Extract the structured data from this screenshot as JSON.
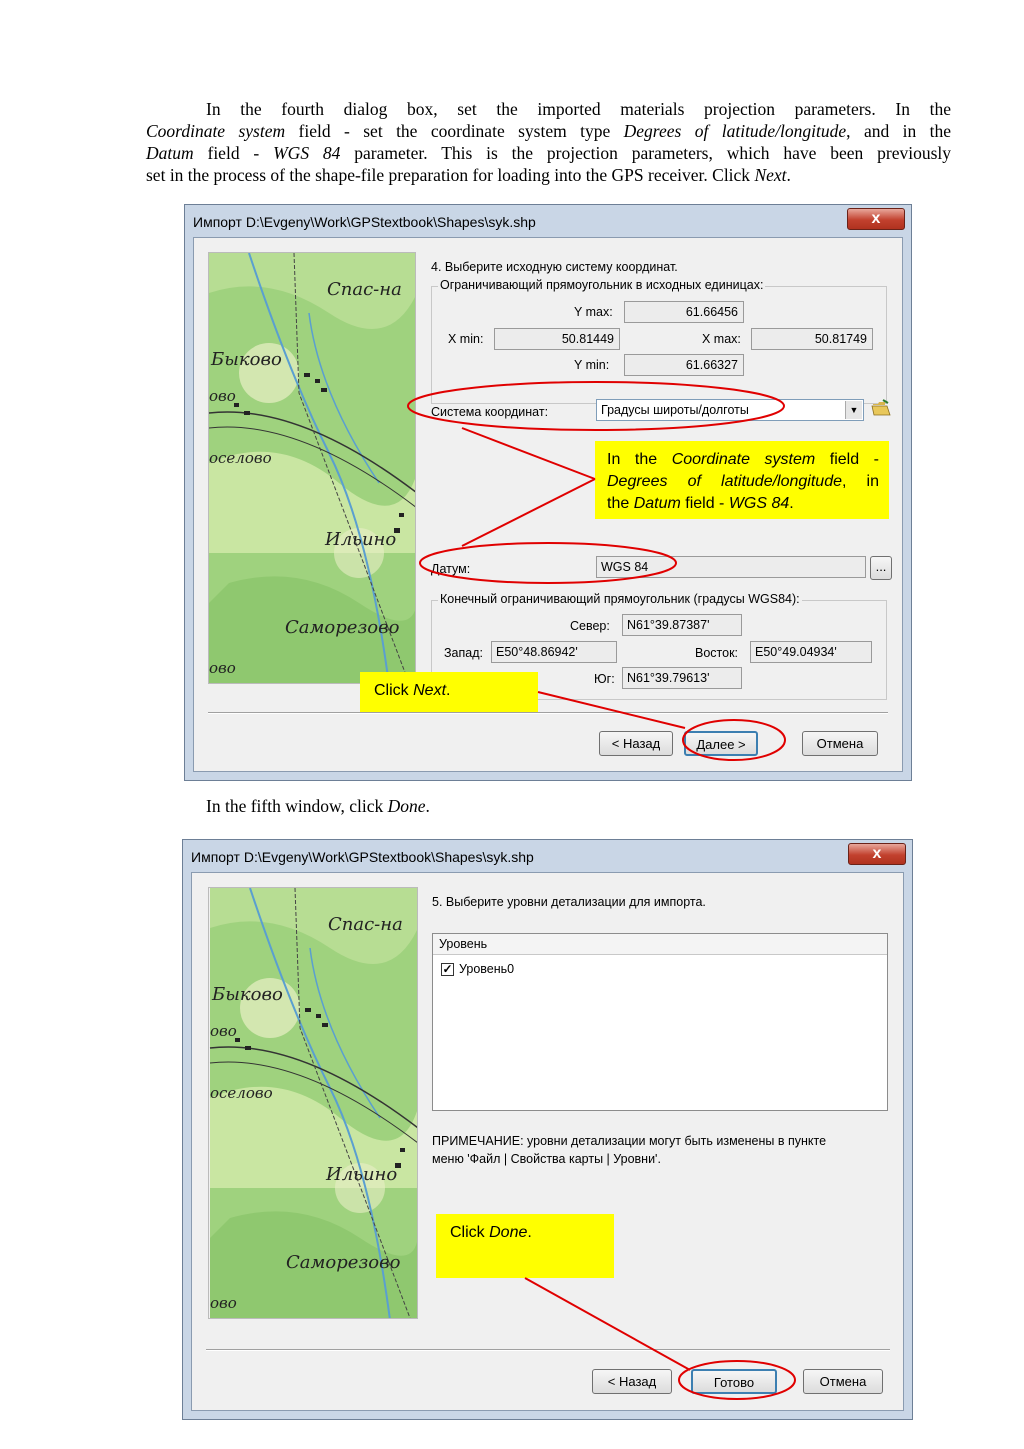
{
  "intro": {
    "line1": "In the fourth dialog box, set the imported materials projection parameters. In the",
    "line2_field1": "Coordinate system",
    "line2_mid": " field - set the coordinate system type ",
    "line2_value1": "Degrees of latitude/longitude",
    "line2_end": ", and in the",
    "line3_field2": "Datum",
    "line3_mid": " field - ",
    "line3_value2": "WGS 84",
    "line3_end": " parameter. This is the projection parameters, which have been previously",
    "line4_start": "set in the process of the shape-file preparation for loading into the GPS receiver. Click ",
    "line4_next": "Next",
    "line4_end": "."
  },
  "dialog1": {
    "title": "Импорт D:\\Evgeny\\Work\\GPStextbook\\Shapes\\syk.shp",
    "close": "x",
    "step": "4. Выберите исходную систему координат.",
    "bounds_group": "Ограничивающий прямоугольник в исходных единицах:",
    "ymax_label": "Y max:",
    "ymax": "61.66456",
    "xmin_label": "X min:",
    "xmin": "50.81449",
    "xmax_label": "X max:",
    "xmax": "50.81749",
    "ymin_label": "Y min:",
    "ymin": "61.66327",
    "coord_label": "Система координат:",
    "coord_value": "Градусы широты/долготы",
    "datum_label": "Датум:",
    "datum_value": "WGS 84",
    "datum_btn": "...",
    "final_group": "Конечный ограничивающий прямоугольник (градусы WGS84):",
    "north_label": "Север:",
    "north": "N61°39.87387'",
    "west_label": "Запад:",
    "west": "E50°48.86942'",
    "east_label": "Восток:",
    "east": "E50°49.04934'",
    "south_label": "Юг:",
    "south": "N61°39.79613'",
    "back": "< Назад",
    "next": "Далее >",
    "cancel": "Отмена"
  },
  "callout1": {
    "p1": "In the ",
    "f1": "Coordinate system",
    "p2": " field -",
    "v1": "Degrees of latitude/longitude",
    "p3": ", in",
    "p4": "the ",
    "f2": "Datum",
    "p5": " field - ",
    "v2": "WGS 84",
    "p6": "."
  },
  "callout2": {
    "p1": "Click ",
    "v": "Next",
    "p2": "."
  },
  "middle": {
    "p1": "In the fifth window, click ",
    "v": "Done",
    "p2": "."
  },
  "dialog2": {
    "title": "Импорт D:\\Evgeny\\Work\\GPStextbook\\Shapes\\syk.shp",
    "close": "x",
    "step": "5. Выберите уровни детализации для импорта.",
    "list_header": "Уровень",
    "level0": "Уровень0",
    "note_line1": "ПРИМЕЧАНИЕ: уровни детализации могут быть изменены в пункте",
    "note_line2": "меню 'Файл | Свойства карты | Уровни'.",
    "back": "< Назад",
    "done": "Готово",
    "cancel": "Отмена"
  },
  "callout3": {
    "p1": "Click ",
    "v": "Done",
    "p2": "."
  },
  "map_labels": [
    "Спас-на",
    "Быково",
    "ово",
    "оселово",
    "Ильино",
    "Саморезово",
    "ово"
  ],
  "colors": {
    "callout_yellow": "#ffff00",
    "annotation_red": "#e00000"
  }
}
